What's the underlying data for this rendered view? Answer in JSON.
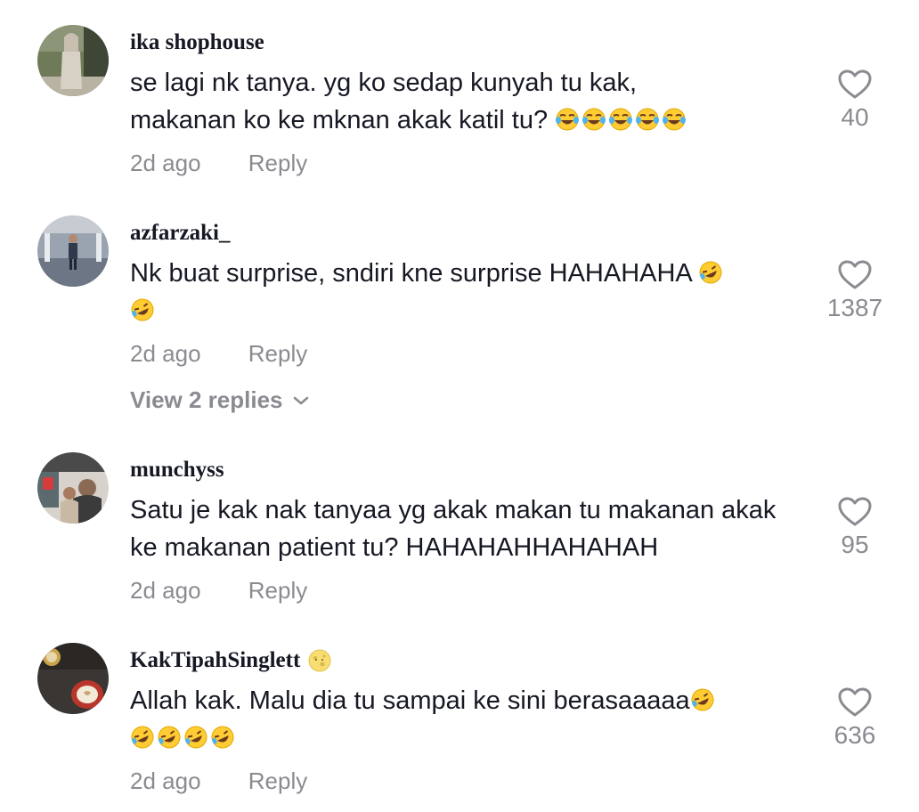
{
  "comments": [
    {
      "username": "ika shophouse",
      "text": "se lagi nk tanya. yg ko sedap kunyah tu kak, makanan ko ke mknan akak katil tu? 😂😂😂😂😂",
      "time": "2d ago",
      "reply_label": "Reply",
      "likes": "40",
      "avatar_icon": "avatar-photo-person-standing"
    },
    {
      "username": "azfarzaki_",
      "text": "Nk buat surprise, sndiri kne surprise HAHAHAHA 🤣🤣",
      "time": "2d ago",
      "reply_label": "Reply",
      "likes": "1387",
      "view_replies": "View 2 replies",
      "avatar_icon": "avatar-photo-hallway"
    },
    {
      "username": "munchyss",
      "text": "Satu je kak nak tanyaa yg akak makan tu makanan akak ke makanan patient tu? HAHAHAHHAHAHAH",
      "time": "2d ago",
      "reply_label": "Reply",
      "likes": "95",
      "avatar_icon": "avatar-photo-shop"
    },
    {
      "username": "KakTipahSinglett",
      "username_emoji": "🌝",
      "text": "Allah kak. Malu dia tu sampai ke sini berasaaaaa🤣🤣🤣🤣🤣",
      "time": "2d ago",
      "reply_label": "Reply",
      "likes": "636",
      "avatar_icon": "avatar-photo-coffee"
    }
  ],
  "colors": {
    "text_primary": "#161823",
    "text_secondary": "#8a8b91",
    "heart_outline": "#8a8b91",
    "background": "#ffffff"
  },
  "icons": {
    "like": "heart-outline-icon",
    "expand": "chevron-down-icon"
  }
}
